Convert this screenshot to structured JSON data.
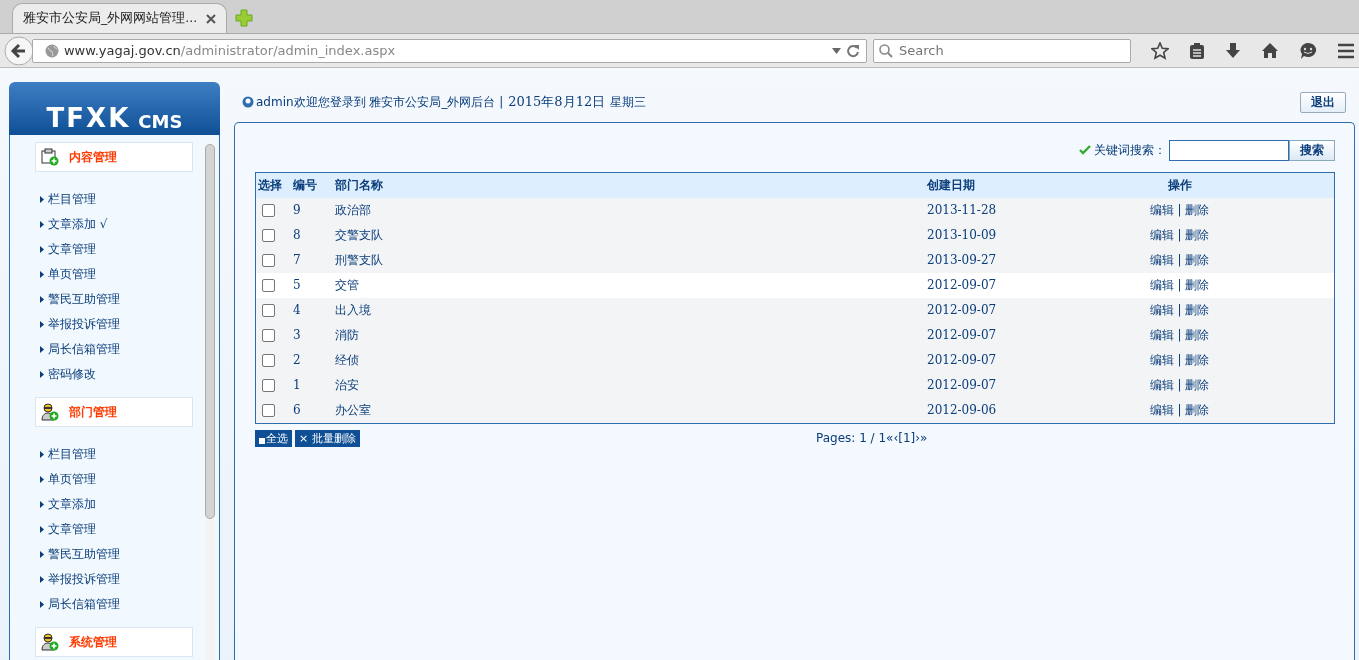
{
  "browser": {
    "tab_title": "雅安市公安局_外网网站管理...",
    "url_host": "www.yagaj.gov.cn",
    "url_path": "/administrator/admin_index.aspx",
    "search_placeholder": "Search"
  },
  "header": {
    "logo": "TFXK",
    "logo_sub": "CMS",
    "welcome": "admin欢迎您登录到 雅安市公安局_外网后台 |",
    "date": "2015年8月12日",
    "weekday": "星期三",
    "logout": "退出"
  },
  "sidebar": {
    "groups": [
      {
        "title": "内容管理",
        "kind": "content",
        "items": [
          "栏目管理",
          "文章添加 √",
          "文章管理",
          "单页管理",
          "警民互助管理",
          "举报投诉管理",
          "局长信箱管理",
          "密码修改"
        ]
      },
      {
        "title": "部门管理",
        "kind": "user",
        "items": [
          "栏目管理",
          "单页管理",
          "文章添加",
          "文章管理",
          "警民互助管理",
          "举报投诉管理",
          "局长信箱管理"
        ]
      },
      {
        "title": "系统管理",
        "kind": "user"
      }
    ]
  },
  "search": {
    "label": "关键词搜索：",
    "button": "搜索"
  },
  "table": {
    "columns": [
      "选择",
      "编号",
      "部门名称",
      "创建日期",
      "操作"
    ],
    "action_separator": "|",
    "rows": [
      {
        "checked": false,
        "highlighted": false,
        "id": "9",
        "name": "政治部",
        "date": "2013-11-28",
        "edit": "编辑",
        "delete": "删除"
      },
      {
        "checked": false,
        "highlighted": false,
        "id": "8",
        "name": "交警支队",
        "date": "2013-10-09",
        "edit": "编辑",
        "delete": "删除"
      },
      {
        "checked": false,
        "highlighted": false,
        "id": "7",
        "name": "刑警支队",
        "date": "2013-09-27",
        "edit": "编辑",
        "delete": "删除"
      },
      {
        "checked": false,
        "highlighted": true,
        "id": "5",
        "name": "交管",
        "date": "2012-09-07",
        "edit": "编辑",
        "delete": "删除"
      },
      {
        "checked": false,
        "highlighted": false,
        "id": "4",
        "name": "出入境",
        "date": "2012-09-07",
        "edit": "编辑",
        "delete": "删除"
      },
      {
        "checked": false,
        "highlighted": false,
        "id": "3",
        "name": "消防",
        "date": "2012-09-07",
        "edit": "编辑",
        "delete": "删除"
      },
      {
        "checked": false,
        "highlighted": false,
        "id": "2",
        "name": "经侦",
        "date": "2012-09-07",
        "edit": "编辑",
        "delete": "删除"
      },
      {
        "checked": false,
        "highlighted": false,
        "id": "1",
        "name": "治安",
        "date": "2012-09-07",
        "edit": "编辑",
        "delete": "删除"
      },
      {
        "checked": false,
        "highlighted": false,
        "id": "6",
        "name": "办公室",
        "date": "2012-09-06",
        "edit": "编辑",
        "delete": "删除"
      }
    ]
  },
  "actions": {
    "select_all": "全选",
    "batch_delete": "× 批量删除"
  },
  "pagination": "Pages: 1 / 1«‹[1]›»"
}
